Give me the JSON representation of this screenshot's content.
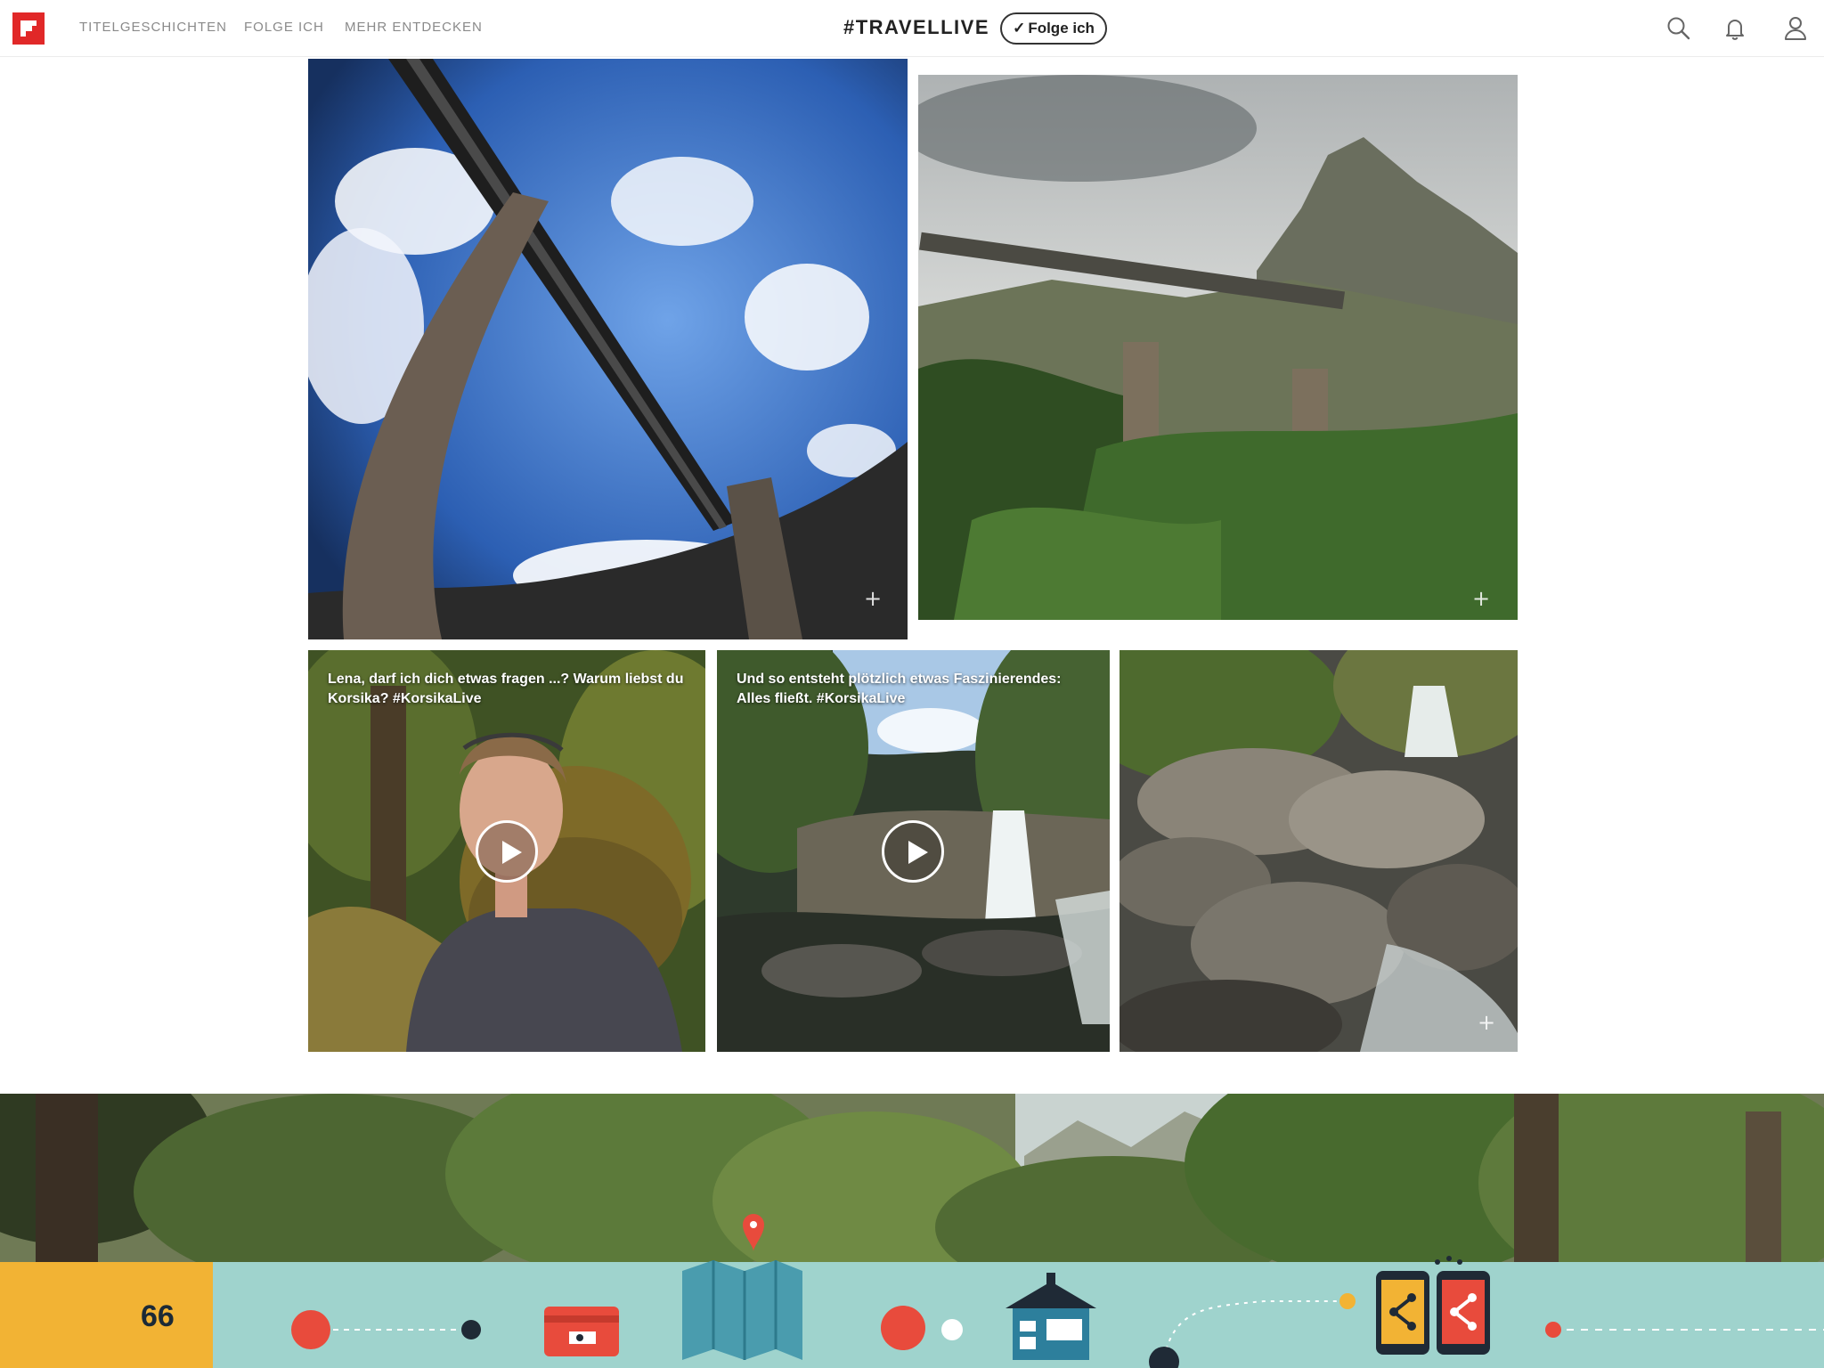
{
  "header": {
    "nav": [
      "TITELGESCHICHTEN",
      "FOLGE ICH",
      "MEHR ENTDECKEN"
    ],
    "topic_title": "#TRAVELLIVE",
    "follow_button": {
      "check": "✓",
      "label": "Folge ich"
    },
    "icons": [
      "search-icon",
      "bell-icon",
      "user-icon"
    ]
  },
  "grid": {
    "items": [
      {
        "name": "bridge-fisheye-photo",
        "add": "+"
      },
      {
        "name": "mountain-bridge-photo",
        "add": "+"
      },
      {
        "name": "video-lena-interview",
        "caption": "Lena, darf ich dich etwas fragen ...? Warum liebst du Korsika? #KorsikaLive"
      },
      {
        "name": "video-waterfall",
        "caption": "Und so entsteht plötzlich etwas Faszinierendes: Alles fließt. #KorsikaLive"
      },
      {
        "name": "river-rocks-photo",
        "add": "+"
      }
    ]
  },
  "footer": {
    "page_number": "66",
    "colors": {
      "page_box": "#f2b334",
      "strip": "#9fd3cd",
      "accent": "#e84b3c",
      "dark": "#1f2a36"
    },
    "icons": [
      "card-icon",
      "map-pin-icon",
      "house-icon",
      "share-phones-icon"
    ]
  }
}
